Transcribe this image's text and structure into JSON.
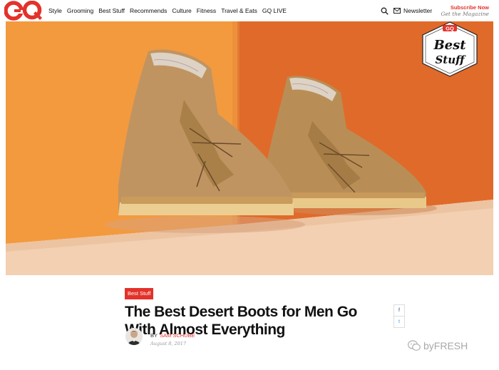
{
  "brand": {
    "logo_text": "GQ",
    "accent": "#e3322b"
  },
  "nav": {
    "links": [
      "Style",
      "Grooming",
      "Best Stuff",
      "Recommends",
      "Culture",
      "Fitness",
      "Travel & Eats",
      "GQ LIVE"
    ],
    "newsletter_label": "Newsletter",
    "subscribe_label": "Subscribe Now",
    "get_magazine_label": "Get the Magazine"
  },
  "icons": {
    "search": "search-icon",
    "mail": "mail-icon",
    "facebook": "facebook-icon",
    "twitter": "twitter-icon"
  },
  "badge": {
    "top": "GQ",
    "line1": "Best",
    "line2": "Stuff"
  },
  "article": {
    "tag": "Best Stuff",
    "headline": "The Best Desert Boots for Men Go With Almost Everything",
    "byline_prefix": "BY",
    "author": "SAM SCHUBE",
    "date": "August 8, 2017"
  },
  "share": {
    "facebook": "f",
    "twitter": "t"
  },
  "watermark": {
    "text": "byFRESH"
  }
}
